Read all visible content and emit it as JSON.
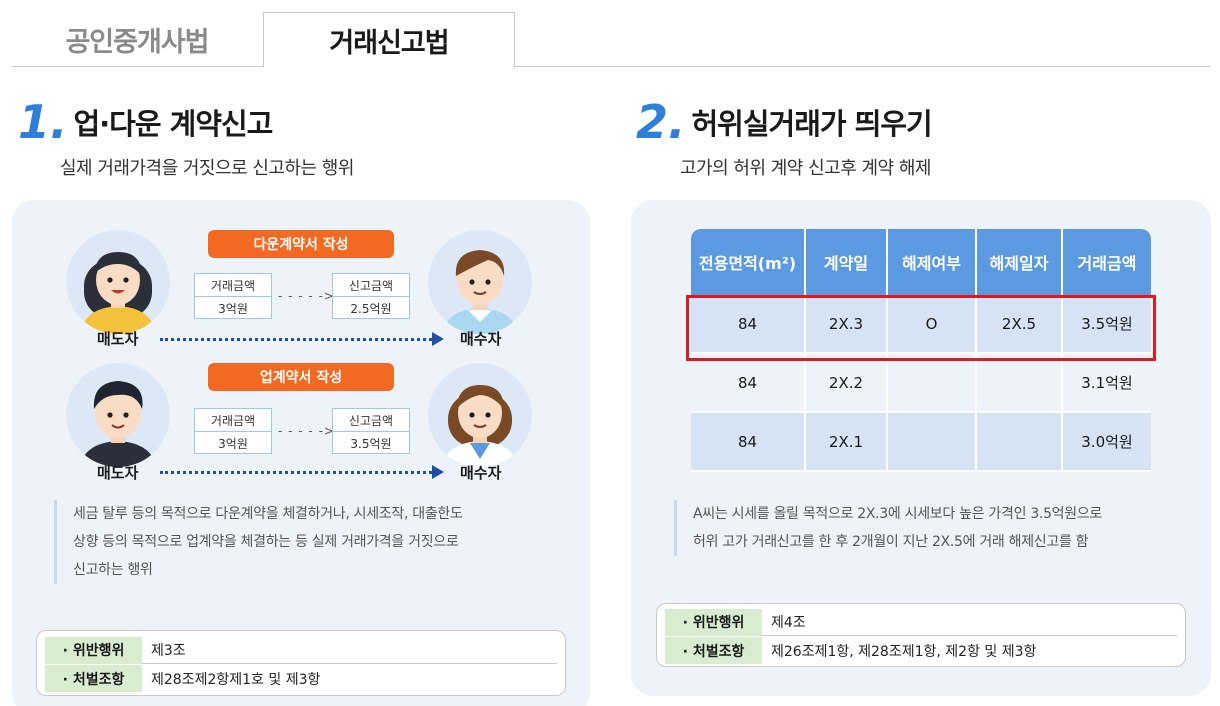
{
  "tabs": [
    {
      "label": "공인중개사법",
      "active": false
    },
    {
      "label": "거래신고법",
      "active": true
    }
  ],
  "section1": {
    "number": "1.",
    "title": "업·다운 계약신고",
    "subtitle": "실제 거래가격을 거짓으로 신고하는 행위",
    "down": {
      "pill": "다운계약서 작성",
      "trade_label": "거래금액",
      "trade_value": "3억원",
      "report_label": "신고금액",
      "report_value": "2.5억원",
      "dash": "- - - - ->",
      "seller": "매도자",
      "buyer": "매수자"
    },
    "up": {
      "pill": "업계약서 작성",
      "trade_label": "거래금액",
      "trade_value": "3억원",
      "report_label": "신고금액",
      "report_value": "3.5억원",
      "dash": "- - - - ->",
      "seller": "매도자",
      "buyer": "매수자"
    },
    "description": [
      "세금 탈루 등의 목적으로 다운계약을 체결하거나, 시세조작, 대출한도",
      "상향 등의 목적으로 업계약을 체결하는 등 실제 거래가격을 거짓으로",
      "신고하는 행위"
    ],
    "law": {
      "violation_key": "· 위반행위",
      "violation_val": "제3조",
      "penalty_key": "· 처벌조항",
      "penalty_val": "제28조제2항제1호 및 제3항"
    }
  },
  "section2": {
    "number": "2.",
    "title": "허위실거래가 띄우기",
    "subtitle": "고가의 허위 계약 신고후 계약 해제",
    "table": {
      "headers": [
        "전용면적(m²)",
        "계약일",
        "해제여부",
        "해제일자",
        "거래금액"
      ],
      "rows": [
        [
          "84",
          "2X.3",
          "O",
          "2X.5",
          "3.5억원"
        ],
        [
          "84",
          "2X.2",
          "",
          "",
          "3.1억원"
        ],
        [
          "84",
          "2X.1",
          "",
          "",
          "3.0억원"
        ]
      ]
    },
    "description": [
      "A씨는 시세를 올릴 목적으로 2X.3에 시세보다 높은 가격인 3.5억원으로",
      "허위 고가 거래신고를 한 후 2개월이 지난 2X.5에 거래 해제신고를 함"
    ],
    "law": {
      "violation_key": "· 위반행위",
      "violation_val": "제4조",
      "penalty_key": "· 처벌조항",
      "penalty_val": "제26조제1항, 제28조제1항, 제2항 및 제3항"
    }
  },
  "colors": {
    "accent_blue": "#2f7fd8",
    "pill_orange": "#f26a21",
    "table_header": "#5b9ae0",
    "highlight_red": "#e0191e",
    "law_key_bg": "#d8ecd0"
  }
}
